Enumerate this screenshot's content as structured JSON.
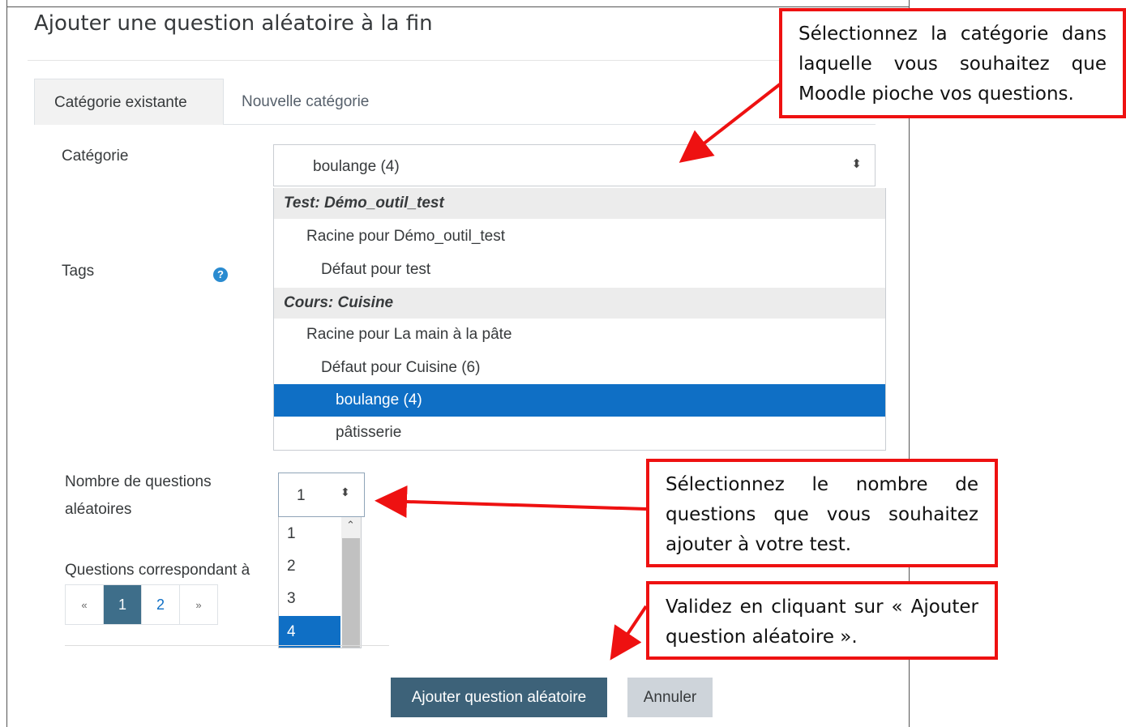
{
  "modal": {
    "title": "Ajouter une question aléatoire à la fin",
    "tabs": [
      {
        "label": "Catégorie existante",
        "active": true
      },
      {
        "label": "Nouvelle catégorie",
        "active": false
      }
    ]
  },
  "form": {
    "category_label": "Catégorie",
    "category_selected": "boulange (4)",
    "category_options": [
      {
        "label": "Test: Démo_outil_test",
        "group": true
      },
      {
        "label": "Racine pour Démo_outil_test",
        "indent": 1
      },
      {
        "label": "Défaut pour test",
        "indent": 2
      },
      {
        "label": "Cours: Cuisine",
        "group": true
      },
      {
        "label": "Racine pour La main à la pâte",
        "indent": 1
      },
      {
        "label": "Défaut pour Cuisine (6)",
        "indent": 2
      },
      {
        "label": "boulange (4)",
        "indent": 3,
        "selected": true
      },
      {
        "label": "pâtisserie",
        "indent": 3
      }
    ],
    "tags_label": "Tags",
    "help_icon": "?",
    "count_label_line1": "Nombre de questions",
    "count_label_line2": "aléatoires",
    "count_selected": "1",
    "count_options": [
      "1",
      "2",
      "3",
      "4"
    ],
    "count_selected_highlight": "4",
    "matching_label": "Questions correspondant à",
    "pagination": {
      "prev": "«",
      "pages": [
        "1",
        "2"
      ],
      "current": "1",
      "next": "»"
    },
    "submit_label": "Ajouter question aléatoire",
    "cancel_label": "Annuler"
  },
  "callouts": {
    "category": "Sélectionnez la catégorie dans laquelle vous souhaitez que Moodle pioche vos questions.",
    "count": "Sélectionnez le nombre de questions que vous souhaitez ajouter à votre test.",
    "submit": "Validez en cliquant sur « Ajouter question aléatoire »."
  },
  "colors": {
    "accent": "#0f6fc5",
    "primary_button": "#3d6279",
    "callout_border": "#ee1111"
  }
}
